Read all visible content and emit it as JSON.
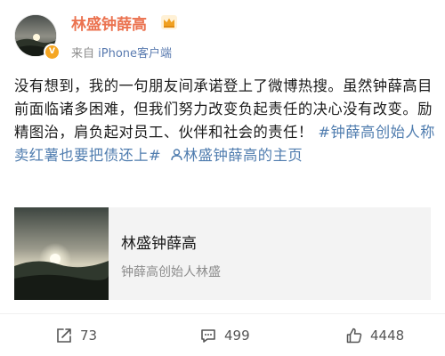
{
  "post": {
    "author": "林盛钟薛高",
    "source_prefix": "来自",
    "source_app": "iPhone客户端",
    "text_1": "没有想到，我的一句朋友间承诺登上了微博热搜。虽然钟薛高目前面临诸多困难，但我们努力改变负起责任的决心没有改变。励精图治，肩负起对员工、伙伴和社会的责任！",
    "hashtag": "#钟薛高创始人称卖红薯也要把债还上#",
    "mention": "林盛钟薛高的主页",
    "verified_badge": "V"
  },
  "card": {
    "title": "林盛钟薛高",
    "subtitle": "钟薛高创始人林盛"
  },
  "actions": {
    "repost_count": "73",
    "comment_count": "499",
    "like_count": "4448"
  },
  "icons": {
    "repost": "share-icon",
    "comment": "comment-icon",
    "like": "thumbs-up-icon",
    "crown": "crown-icon",
    "mention": "person-icon"
  }
}
